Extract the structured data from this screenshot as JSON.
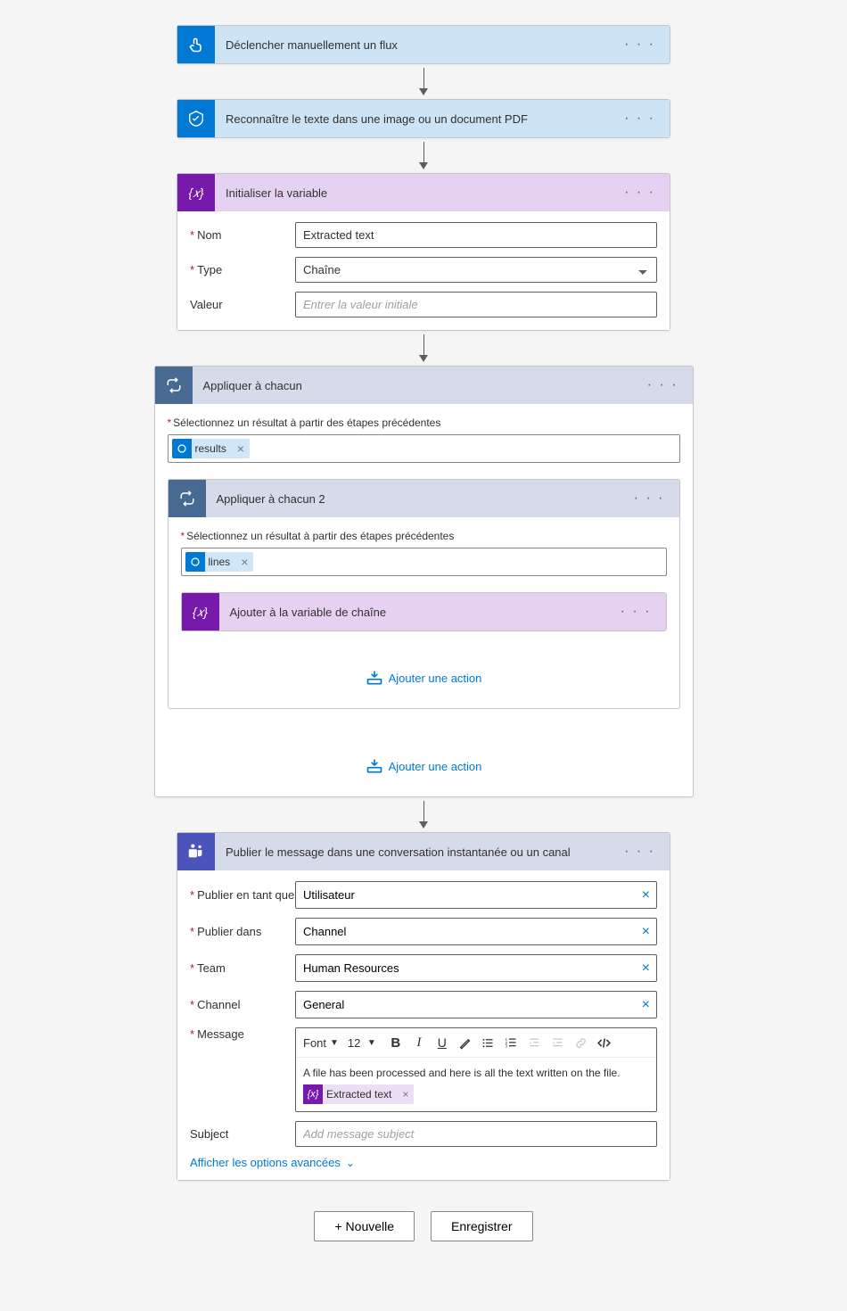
{
  "steps": {
    "manual": {
      "title": "Déclencher manuellement un flux"
    },
    "ocr": {
      "title": "Reconnaître le texte dans une image ou un document PDF"
    },
    "initvar": {
      "title": "Initialiser la variable",
      "labels": {
        "name": "Nom",
        "type": "Type",
        "value": "Valeur"
      },
      "fields": {
        "name": "Extracted text",
        "type": "Chaîne",
        "value_placeholder": "Entrer la valeur initiale"
      }
    },
    "foreach1": {
      "title": "Appliquer à chacun",
      "preceding_label": "Sélectionnez un résultat à partir des étapes précédentes",
      "token": "results"
    },
    "foreach2": {
      "title": "Appliquer à chacun 2",
      "preceding_label": "Sélectionnez un résultat à partir des étapes précédentes",
      "token": "lines"
    },
    "append": {
      "title": "Ajouter à la variable de chaîne"
    },
    "add_action": "Ajouter une action",
    "teams": {
      "title": "Publier le message dans une conversation instantanée ou un canal",
      "labels": {
        "post_as": "Publier en tant que",
        "post_in": "Publier dans",
        "team": "Team",
        "channel": "Channel",
        "message": "Message",
        "subject": "Subject"
      },
      "fields": {
        "post_as": "Utilisateur",
        "post_in": "Channel",
        "team": "Human Resources",
        "channel": "General",
        "message_text": "A file has been processed and here is all the text written on the file.",
        "message_token": "Extracted text",
        "subject_placeholder": "Add message subject"
      },
      "rte": {
        "font": "Font",
        "size": "12"
      },
      "advanced": "Afficher les options avancées"
    }
  },
  "footer": {
    "new": "+ Nouvelle",
    "save": "Enregistrer"
  }
}
